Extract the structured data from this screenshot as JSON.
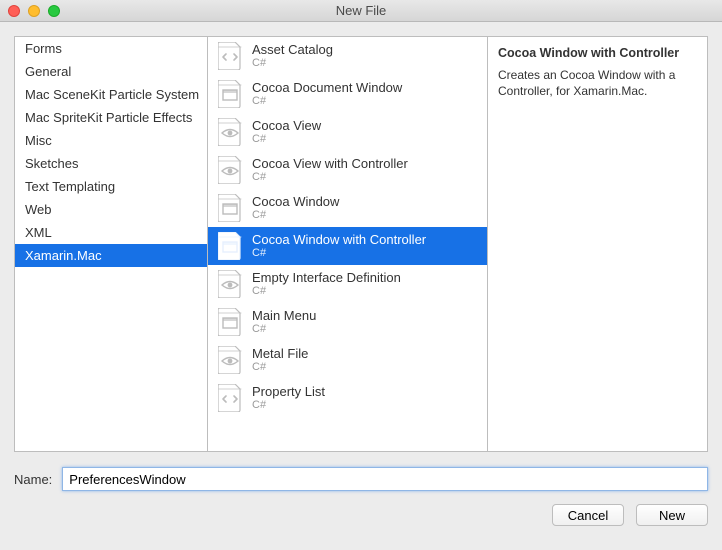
{
  "window": {
    "title": "New File"
  },
  "categories": {
    "selectedIndex": 9,
    "items": [
      "Forms",
      "General",
      "Mac SceneKit Particle System",
      "Mac SpriteKit Particle Effects",
      "Misc",
      "Sketches",
      "Text Templating",
      "Web",
      "XML",
      "Xamarin.Mac"
    ]
  },
  "templates": {
    "selectedIndex": 5,
    "items": [
      {
        "label": "Asset Catalog",
        "sub": "C#",
        "icon": "code-file-icon"
      },
      {
        "label": "Cocoa Document Window",
        "sub": "C#",
        "icon": "window-file-icon"
      },
      {
        "label": "Cocoa View",
        "sub": "C#",
        "icon": "view-file-icon"
      },
      {
        "label": "Cocoa View with Controller",
        "sub": "C#",
        "icon": "view-file-icon"
      },
      {
        "label": "Cocoa Window",
        "sub": "C#",
        "icon": "window-file-icon"
      },
      {
        "label": "Cocoa Window with Controller",
        "sub": "C#",
        "icon": "window-file-icon"
      },
      {
        "label": "Empty Interface Definition",
        "sub": "C#",
        "icon": "view-file-icon"
      },
      {
        "label": "Main Menu",
        "sub": "C#",
        "icon": "window-file-icon"
      },
      {
        "label": "Metal File",
        "sub": "C#",
        "icon": "view-file-icon"
      },
      {
        "label": "Property List",
        "sub": "C#",
        "icon": "code-file-icon"
      }
    ]
  },
  "detail": {
    "title": "Cocoa Window with Controller",
    "description": "Creates an Cocoa Window with a Controller, for Xamarin.Mac."
  },
  "name_row": {
    "label": "Name:",
    "value": "PreferencesWindow"
  },
  "buttons": {
    "cancel": "Cancel",
    "confirm": "New"
  }
}
